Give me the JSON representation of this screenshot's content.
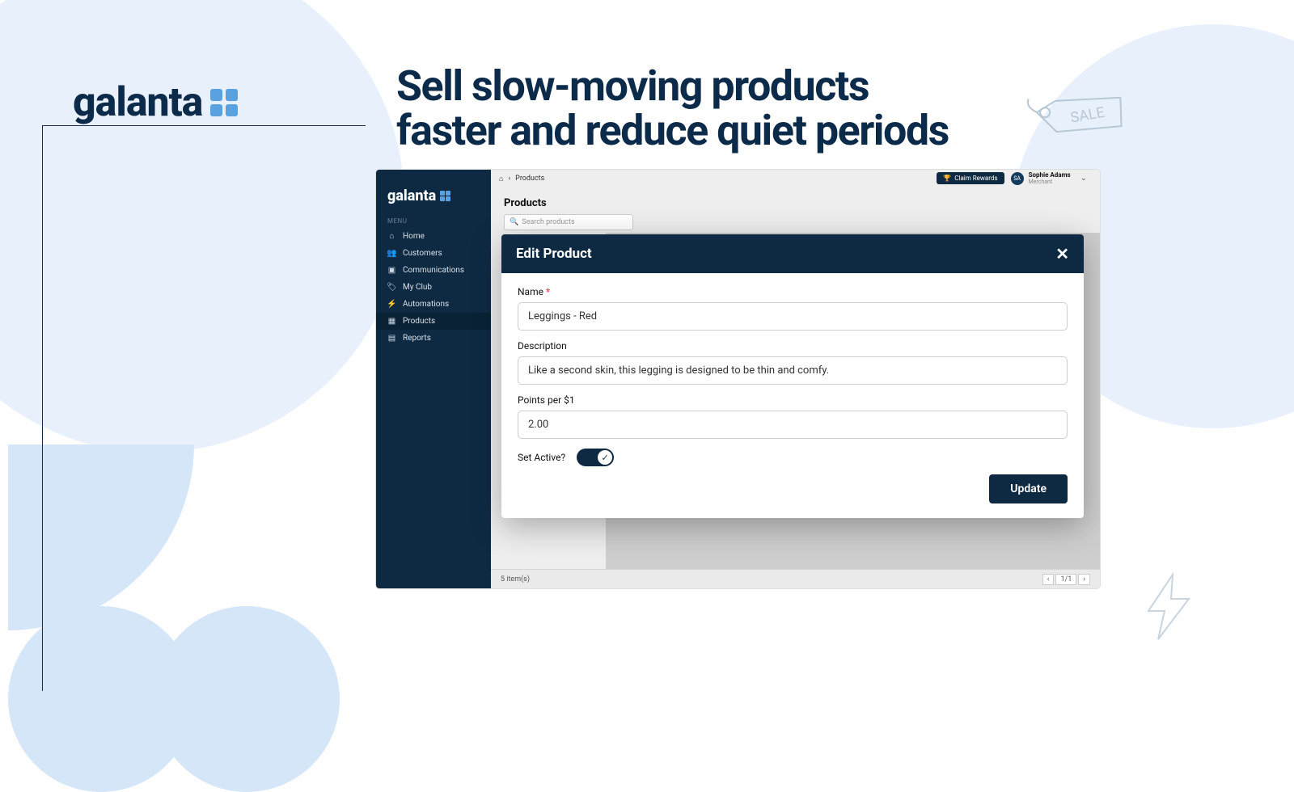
{
  "brand": "galanta",
  "headline": "Sell slow-moving products faster and reduce quiet periods",
  "sidebar": {
    "brand": "galanta",
    "menu_label": "MENU",
    "items": [
      {
        "label": "Home",
        "icon": "home"
      },
      {
        "label": "Customers",
        "icon": "users"
      },
      {
        "label": "Communications",
        "icon": "chat"
      },
      {
        "label": "My Club",
        "icon": "tag"
      },
      {
        "label": "Automations",
        "icon": "bolt"
      },
      {
        "label": "Products",
        "icon": "box",
        "active": true
      },
      {
        "label": "Reports",
        "icon": "report"
      }
    ]
  },
  "topbar": {
    "breadcrumb_root_icon": "home",
    "breadcrumb_sep": "›",
    "breadcrumb_page": "Products",
    "claim_rewards": "Claim Rewards",
    "user_initials": "SA",
    "user_name": "Sophie Adams",
    "user_role": "Merchant"
  },
  "page": {
    "title": "Products",
    "search_placeholder": "Search products",
    "item_count": "5 item(s)",
    "page_indicator": "1/1"
  },
  "modal": {
    "title": "Edit Product",
    "name_label": "Name",
    "name_value": "Leggings - Red",
    "desc_label": "Description",
    "desc_value": "Like a second skin, this legging is designed to be thin and comfy.",
    "points_label": "Points per $1",
    "points_value": "2.00",
    "active_label": "Set Active?",
    "active_on": true,
    "update_btn": "Update"
  },
  "colors": {
    "navy": "#0e2a43",
    "accent": "#5aa1e0",
    "soft_blue": "#e8f1fb"
  }
}
